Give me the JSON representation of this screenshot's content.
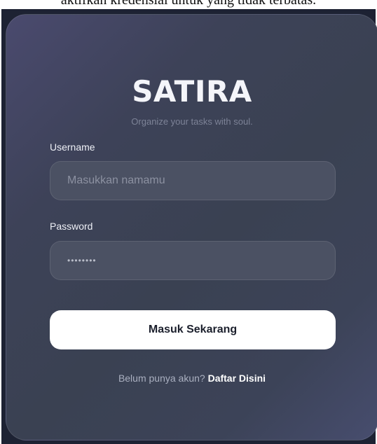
{
  "top_caption": "aktifkan kredensial untuk yang tidak terbatas.",
  "brand": {
    "title": "SATIRA",
    "tagline": "Organize your tasks with soul."
  },
  "form": {
    "username_label": "Username",
    "username_placeholder": "Masukkan namamu",
    "username_value": "",
    "password_label": "Password",
    "password_value": "••••••••",
    "submit_label": "Masuk Sekarang"
  },
  "register": {
    "prompt": "Belum punya akun? ",
    "link_label": "Daftar Disini"
  },
  "colors": {
    "card_gradient_start": "#4a4a6e",
    "card_gradient_mid": "#3a4152",
    "card_gradient_end": "#474d6e",
    "input_bg": "#4b5163",
    "button_bg": "#ffffff",
    "button_text": "#1b1f2c",
    "frame_bg": "#1d2233"
  }
}
